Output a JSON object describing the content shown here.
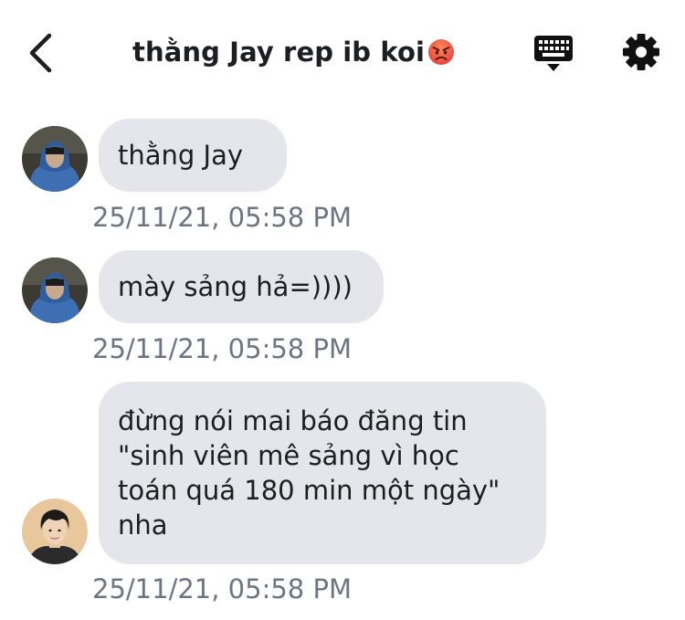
{
  "header": {
    "title": "thằng Jay rep ib koi",
    "title_emoji": "angry-face",
    "back_icon": "chevron-left-icon",
    "keyboard_icon": "keyboard-icon",
    "settings_icon": "gear-icon"
  },
  "messages": [
    {
      "sender": "Jay",
      "text": "thằng Jay",
      "time": "25/11/21, 05:58 PM"
    },
    {
      "sender": "Jay",
      "text": "mày sảng hả=))))",
      "time": "25/11/21, 05:58 PM"
    },
    {
      "sender": "other",
      "lines": [
        "đừng nói mai báo đăng tin",
        "\"sinh viên mê sảng vì học",
        "toán quá 180 min một ngày\"",
        "nha"
      ],
      "time": "25/11/21, 05:58 PM"
    }
  ],
  "colors": {
    "bubble": "#e4e6eb",
    "timestamp": "#6b7583",
    "text": "#1c1e21"
  }
}
